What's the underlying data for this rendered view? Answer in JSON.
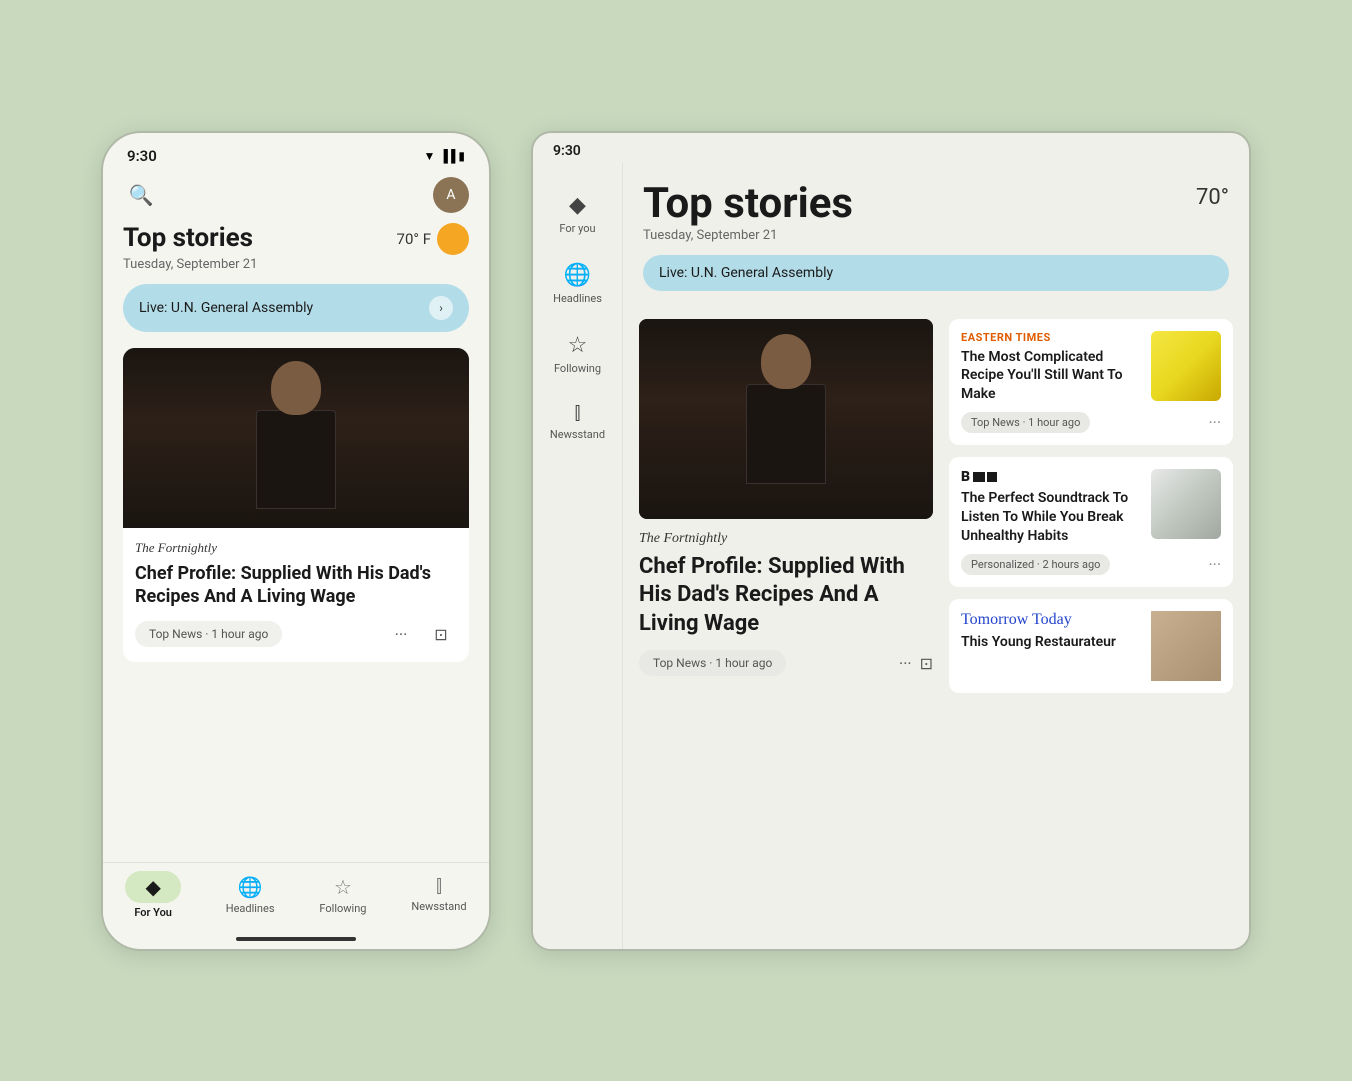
{
  "phone": {
    "status_time": "9:30",
    "header": {
      "search_placeholder": "Search",
      "avatar_initial": "A"
    },
    "top_stories_title": "Top stories",
    "date": "Tuesday, September 21",
    "weather": "70° F",
    "live_banner": "Live: U.N. General Assembly",
    "article": {
      "source": "The Fortnightly",
      "title": "Chef Profile: Supplied With His Dad's Recipes And A Living Wage",
      "meta": "Top News · 1 hour ago"
    },
    "bottom_nav": [
      {
        "label": "For You",
        "icon": "◆",
        "active": true
      },
      {
        "label": "Headlines",
        "icon": "🌐",
        "active": false
      },
      {
        "label": "Following",
        "icon": "☆",
        "active": false
      },
      {
        "label": "Newsstand",
        "icon": "⫿",
        "active": false
      }
    ]
  },
  "tablet": {
    "status_time": "9:30",
    "top_stories_title": "Top stories",
    "date": "Tuesday, September 21",
    "weather": "70°",
    "live_banner": "Live: U.N. General Assembly",
    "sidebar_nav": [
      {
        "label": "For you",
        "icon": "◆"
      },
      {
        "label": "Headlines",
        "icon": "🌐"
      },
      {
        "label": "Following",
        "icon": "☆"
      },
      {
        "label": "Newsstand",
        "icon": "⫿"
      }
    ],
    "main_article": {
      "source": "The Fortnightly",
      "title": "Chef Profile: Supplied With His Dad's Recipes And A Living Wage",
      "meta": "Top News · 1 hour ago"
    },
    "sidebar_articles": [
      {
        "source_label": "EASTERN TIMES",
        "source_class": "eastern-times",
        "title": "The Most Complicated Recipe You'll Still Want To Make",
        "meta": "Top News · 1 hour ago",
        "thumb_class": "food-thumb"
      },
      {
        "source_label": "BE",
        "source_class": "be-label",
        "title": "The Perfect Soundtrack To Listen To While You Break Unhealthy Habits",
        "meta": "Personalized · 2 hours ago",
        "thumb_class": "bird-thumb"
      },
      {
        "source_label": "Tomorrow Today",
        "source_class": "tomorrow-today-label",
        "title": "This Young Restaurateur",
        "meta": "",
        "thumb_class": "person-thumb"
      }
    ]
  }
}
